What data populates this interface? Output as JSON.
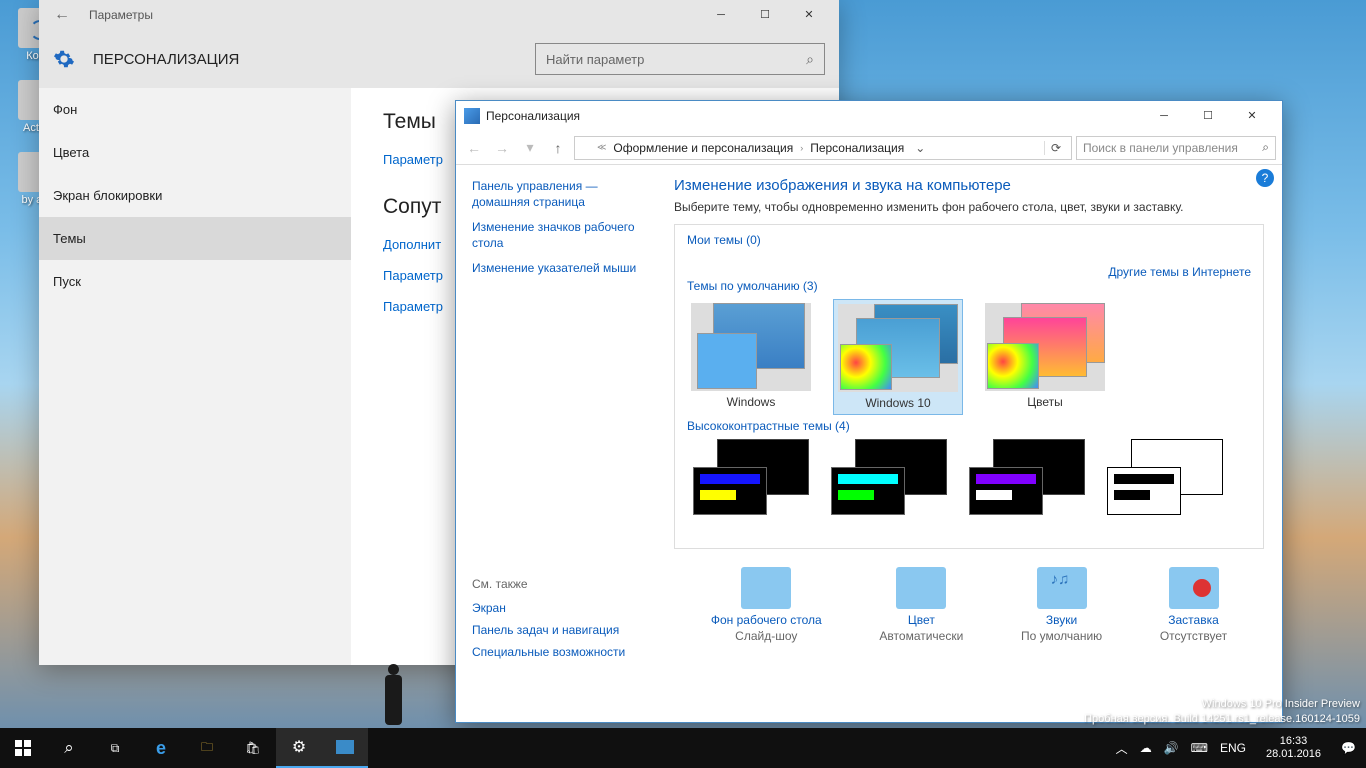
{
  "desktop": {
    "icons": [
      {
        "name": "recycle-bin",
        "label": "Корз"
      },
      {
        "name": "activation",
        "label": "Activa"
      },
      {
        "name": "browser-adguard",
        "label": "by adg"
      }
    ]
  },
  "settingsWindow": {
    "title": "Параметры",
    "heading": "ПЕРСОНАЛИЗАЦИЯ",
    "searchPlaceholder": "Найти параметр",
    "nav": [
      {
        "label": "Фон"
      },
      {
        "label": "Цвета"
      },
      {
        "label": "Экран блокировки"
      },
      {
        "label": "Темы",
        "active": true
      },
      {
        "label": "Пуск"
      }
    ],
    "content": {
      "h1": "Темы",
      "link1": "Параметр",
      "h2": "Сопут",
      "link2": "Дополнит",
      "link3": "Параметр",
      "link4": "Параметр"
    }
  },
  "cpWindow": {
    "title": "Персонализация",
    "breadcrumb": {
      "seg1": "Оформление и персонализация",
      "seg2": "Персонализация"
    },
    "searchPlaceholder": "Поиск в панели управления",
    "side": {
      "home": "Панель управления — домашняя страница",
      "icons": "Изменение значков рабочего стола",
      "pointers": "Изменение указателей мыши",
      "seeAlso": "См. также",
      "screen": "Экран",
      "taskbar": "Панель задач и навигация",
      "access": "Специальные возможности"
    },
    "main": {
      "heading": "Изменение изображения и звука на компьютере",
      "desc": "Выберите тему, чтобы одновременно изменить фон рабочего стола, цвет, звуки и заставку.",
      "myThemes": "Мои темы (0)",
      "onlineLink": "Другие темы в Интернете",
      "defaultThemes": "Темы по умолчанию (3)",
      "themes": [
        {
          "name": "windows",
          "label": "Windows"
        },
        {
          "name": "windows10",
          "label": "Windows 10",
          "selected": true
        },
        {
          "name": "colors",
          "label": "Цветы"
        }
      ],
      "hcThemes": "Высококонтрастные темы (4)"
    },
    "footer": [
      {
        "link": "Фон рабочего стола",
        "value": "Слайд-шоу",
        "icon": "bg"
      },
      {
        "link": "Цвет",
        "value": "Автоматически",
        "icon": "col"
      },
      {
        "link": "Звуки",
        "value": "По умолчанию",
        "icon": "snd"
      },
      {
        "link": "Заставка",
        "value": "Отсутствует",
        "icon": "scr"
      }
    ]
  },
  "watermark": {
    "line1": "Windows 10 Pro Insider Preview",
    "line2": "Пробная версия. Build 14251.rs1_release.160124-1059"
  },
  "taskbar": {
    "lang": "ENG",
    "time": "16:33",
    "date": "28.01.2016"
  }
}
